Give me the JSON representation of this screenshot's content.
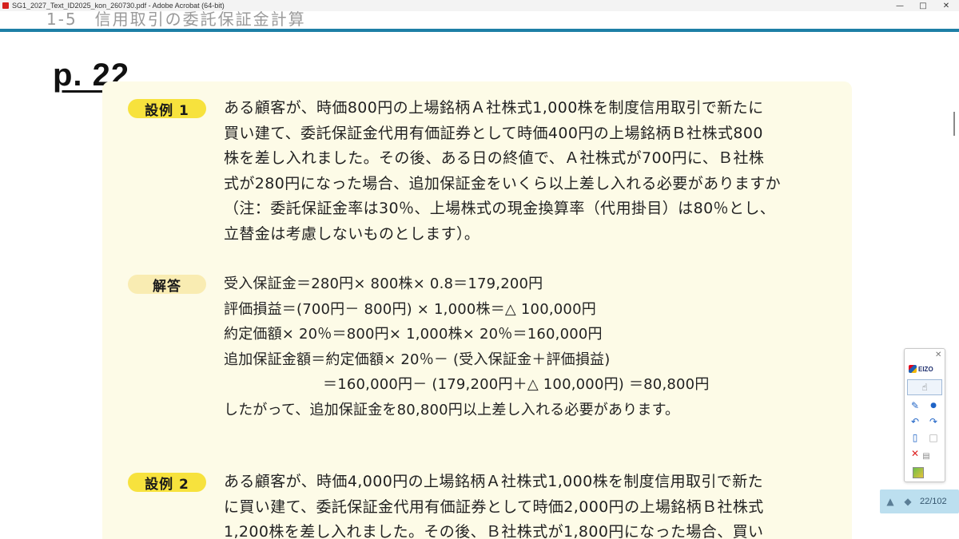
{
  "window": {
    "title": "SG1_2027_Text_ID2025_kon_260730.pdf - Adobe Acrobat (64-bit)",
    "controls": [
      "minimize",
      "maximize",
      "close"
    ]
  },
  "document": {
    "header_fragment": "1-5　信用取引の委託保証金計算",
    "page_label": "p. 22",
    "example1": {
      "badge": "設例 1",
      "lines": [
        "ある顧客が、時価800円の上場銘柄Ａ社株式1,000株を制度信用取引で新たに",
        "買い建て、委託保証金代用有価証券として時価400円の上場銘柄Ｂ社株式800",
        "株を差し入れました。その後、ある日の終値で、Ａ社株式が700円に、Ｂ社株",
        "式が280円になった場合、追加保証金をいくら以上差し入れる必要がありますか",
        "（注：委託保証金率は30％、上場株式の現金換算率（代用掛目）は80％とし、",
        "立替金は考慮しないものとします）。"
      ]
    },
    "answer": {
      "badge": "解答",
      "lines": [
        "受入保証金＝280円× 800株× 0.8＝179,200円",
        "評価損益＝(700円－ 800円) × 1,000株＝△ 100,000円",
        "約定価額× 20％＝800円× 1,000株× 20％＝160,000円",
        "追加保証金額＝約定価額× 20％－ (受入保証金＋評価損益)",
        "＝160,000円－ (179,200円＋△ 100,000円) ＝80,800円",
        "したがって、追加保証金を80,800円以上差し入れる必要があります。"
      ]
    },
    "example2": {
      "badge": "設例 2",
      "lines": [
        "ある顧客が、時価4,000円の上場銘柄Ａ社株式1,000株を制度信用取引で新た",
        "に買い建て、委託保証金代用有価証券として時価2,000円の上場銘柄Ｂ社株式",
        "1,200株を差し入れました。その後、Ｂ社株式が1,800円になった場合、買い"
      ]
    }
  },
  "tool_palette": {
    "brand": "EIZO",
    "tools": [
      "close-icon",
      "cursor-icon",
      "pen-icon",
      "dot-icon",
      "undo-icon",
      "redo-icon",
      "eraser-icon",
      "square-icon",
      "clear-icon",
      "color-swatch"
    ]
  },
  "page_nav": {
    "page_indicator": "22/102"
  },
  "colors": {
    "header_rule": "#1e7fa6",
    "panel_bg": "#fdfbe7",
    "badge_example": "#f7e23d",
    "badge_answer": "#f9ecb2",
    "page_nav_bg": "#bcdfef"
  }
}
